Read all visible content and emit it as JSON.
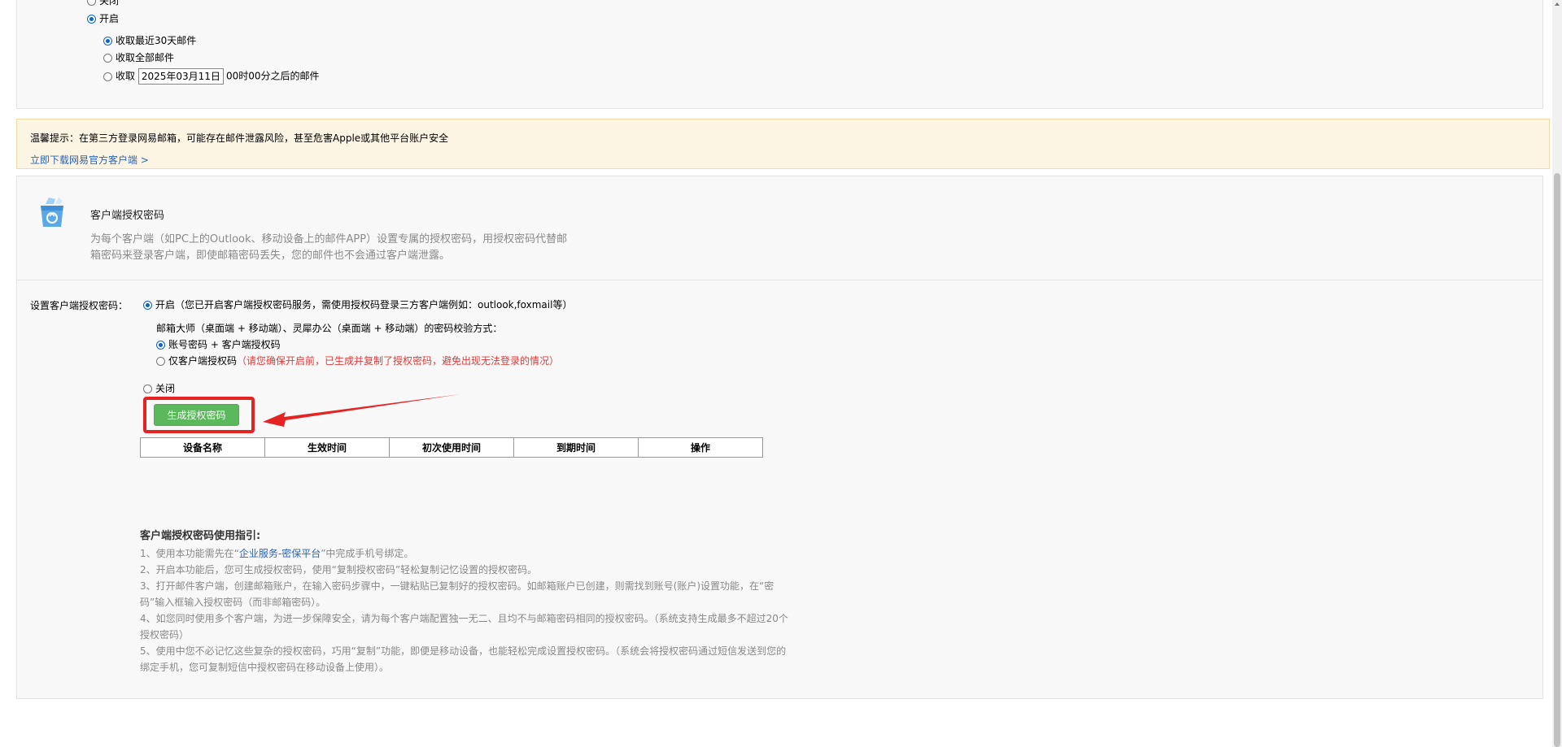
{
  "fetch_settings": {
    "close_label": "关闭",
    "open_label": "开启",
    "opt_30days": "收取最近30天邮件",
    "opt_all": "收取全部邮件",
    "opt_since_prefix": "收取",
    "opt_since_date": "2025年03月11日",
    "opt_since_suffix": "00时00分之后的邮件"
  },
  "warning": {
    "text": "温馨提示：在第三方登录网易邮箱，可能存在邮件泄露风险，甚至危害Apple或其他平台账户安全",
    "link": "立即下载网易官方客户端 >"
  },
  "intro": {
    "icon": "recycle-bin-icon",
    "title": "客户端授权密码",
    "desc": "为每个客户端（如PC上的Outlook、移动设备上的邮件APP）设置专属的授权密码，用授权密码代替邮箱密码来登录客户端，即使邮箱密码丢失，您的邮件也不会通过客户端泄露。"
  },
  "auth_setting": {
    "label": "设置客户端授权密码：",
    "open_label": "开启（您已开启客户端授权密码服务，需使用授权码登录三方客户端例如：outlook,foxmail等）",
    "verify_desc": "邮箱大师（桌面端 + 移动端）、灵犀办公（桌面端 + 移动端）的密码校验方式：",
    "opt_account_plus_auth": "账号密码 + 客户端授权码",
    "opt_auth_only": "仅客户端授权码",
    "opt_auth_only_note": "（请您确保开启前，已生成并复制了授权密码，避免出现无法登录的情况）",
    "close_label": "关闭",
    "generate_button": "生成授权密码"
  },
  "device_table": {
    "headers": [
      "设备名称",
      "生效时间",
      "初次使用时间",
      "到期时间",
      "操作"
    ]
  },
  "guide": {
    "title": "客户端授权密码使用指引:",
    "item1_prefix": "1、使用本功能需先在“",
    "item1_link": "企业服务-密保平台",
    "item1_suffix": "”中完成手机号绑定。",
    "item2": "2、开启本功能后，您可生成授权密码，使用“复制授权密码”轻松复制记忆设置的授权密码。",
    "item3": "3、打开邮件客户端，创建邮箱账户，在输入密码步骤中，一键粘贴已复制好的授权密码。如邮箱账户已创建，则需找到账号(账户)设置功能，在“密码”输入框输入授权密码（而非邮箱密码）。",
    "item4": "4、如您同时使用多个客户端，为进一步保障安全，请为每个客户端配置独一无二、且均不与邮箱密码相同的授权密码。（系统支持生成最多不超过20个授权密码）",
    "item5": "5、使用中您不必记忆这些复杂的授权密码，巧用“复制”功能，即便是移动设备，也能轻松完成设置授权密码。（系统会将授权密码通过短信发送到您的绑定手机，您可复制短信中授权密码在移动设备上使用）。"
  },
  "colors": {
    "accent_green": "#5cb85c",
    "highlight_red": "#e52323",
    "link_blue": "#2a62b8",
    "warning_bg": "#fdf5e4"
  }
}
